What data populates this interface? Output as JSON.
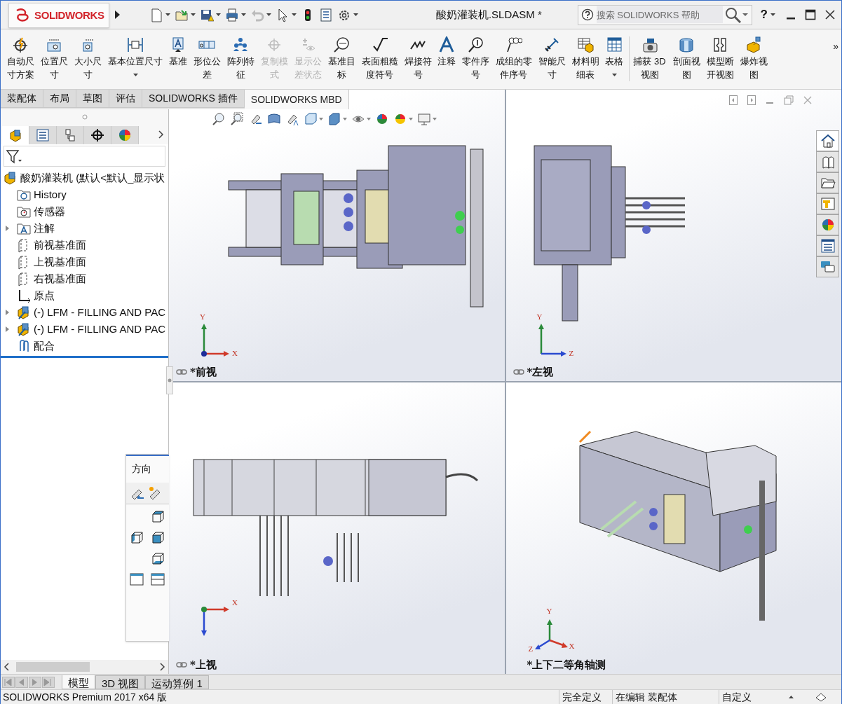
{
  "app": {
    "logo_text": "SOLIDWORKS"
  },
  "window": {
    "title": "酸奶灌装机.SLDASM *"
  },
  "search": {
    "placeholder": "搜索 SOLIDWORKS 帮助"
  },
  "help_menu": "?",
  "ribbon": {
    "buttons": [
      {
        "label": "自动尺寸方案",
        "disabled": false,
        "dropdown": false
      },
      {
        "label": "位置尺寸",
        "disabled": false,
        "dropdown": false
      },
      {
        "label": "大小尺寸",
        "disabled": false,
        "dropdown": false
      },
      {
        "label": "基本位置尺寸",
        "disabled": false,
        "dropdown": true
      },
      {
        "label": "基准",
        "disabled": false,
        "dropdown": false
      },
      {
        "label": "形位公差",
        "disabled": false,
        "dropdown": false
      },
      {
        "label": "阵列特征",
        "disabled": false,
        "dropdown": false
      },
      {
        "label": "复制模式",
        "disabled": true,
        "dropdown": false
      },
      {
        "label": "显示公差状态",
        "disabled": true,
        "dropdown": false
      },
      {
        "label": "基准目标",
        "disabled": false,
        "dropdown": false
      },
      {
        "label": "表面粗糙度符号",
        "disabled": false,
        "dropdown": false
      },
      {
        "label": "焊接符号",
        "disabled": false,
        "dropdown": false
      },
      {
        "label": "注释",
        "disabled": false,
        "dropdown": false
      },
      {
        "label": "零件序号",
        "disabled": false,
        "dropdown": false
      },
      {
        "label": "成组的零件序号",
        "disabled": false,
        "dropdown": false
      },
      {
        "label": "智能尺寸",
        "disabled": false,
        "dropdown": false
      },
      {
        "label": "材料明细表",
        "disabled": false,
        "dropdown": false
      },
      {
        "label": "表格",
        "disabled": false,
        "dropdown": true
      },
      {
        "label": "捕获 3D视图",
        "disabled": false,
        "dropdown": false
      },
      {
        "label": "剖面视图",
        "disabled": false,
        "dropdown": false
      },
      {
        "label": "模型断开视图",
        "disabled": false,
        "dropdown": false
      },
      {
        "label": "爆炸视图",
        "disabled": false,
        "dropdown": false
      }
    ],
    "overflow": "»"
  },
  "command_tabs": [
    {
      "label": "装配体",
      "selected": false
    },
    {
      "label": "布局",
      "selected": false
    },
    {
      "label": "草图",
      "selected": false
    },
    {
      "label": "评估",
      "selected": false
    },
    {
      "label": "SOLIDWORKS 插件",
      "selected": false
    },
    {
      "label": "SOLIDWORKS MBD",
      "selected": true
    }
  ],
  "feature_tree": {
    "panel_tabs": [
      {
        "selected": true
      },
      {
        "selected": false
      },
      {
        "selected": false
      },
      {
        "selected": false
      },
      {
        "selected": false
      }
    ],
    "root": {
      "label": "酸奶灌装机  (默认<默认_显示状",
      "kind": "assembly",
      "children": [
        {
          "label": "History",
          "kind": "history",
          "expandable": false
        },
        {
          "label": "传感器",
          "kind": "sensors",
          "expandable": false
        },
        {
          "label": "注解",
          "kind": "annotations",
          "expandable": true
        },
        {
          "label": "前视基准面",
          "kind": "plane",
          "expandable": false
        },
        {
          "label": "上视基准面",
          "kind": "plane",
          "expandable": false
        },
        {
          "label": "右视基准面",
          "kind": "plane",
          "expandable": false
        },
        {
          "label": "原点",
          "kind": "origin",
          "expandable": false
        },
        {
          "label": "(-) LFM - FILLING AND PAC",
          "kind": "subassembly",
          "expandable": true
        },
        {
          "label": "(-) LFM - FILLING AND PAC",
          "kind": "subassembly",
          "expandable": true
        },
        {
          "label": "配合",
          "kind": "mates",
          "expandable": false
        }
      ]
    }
  },
  "orientation_panel": {
    "title": "方向"
  },
  "viewports": [
    {
      "label": "*前视",
      "axes": [
        "Y",
        "X"
      ]
    },
    {
      "label": "*左视",
      "axes": [
        "Y",
        "Z"
      ]
    },
    {
      "label": "*上视",
      "axes": [
        "X"
      ]
    },
    {
      "label": "*上下二等角轴测",
      "axes": [
        "Y",
        "X",
        "Z"
      ]
    }
  ],
  "task_pane_tabs": [
    {
      "selected": true
    },
    {
      "selected": false
    },
    {
      "selected": false
    },
    {
      "selected": false
    },
    {
      "selected": false
    },
    {
      "selected": false
    },
    {
      "selected": false
    }
  ],
  "bottom_tabs": [
    {
      "label": "模型",
      "selected": true
    },
    {
      "label": "3D 视图",
      "selected": false
    },
    {
      "label": "运动算例 1",
      "selected": false
    }
  ],
  "status_bar": {
    "product": "SOLIDWORKS Premium 2017 x64 版",
    "fields": [
      "完全定义",
      "在编辑 装配体",
      "自定义"
    ]
  }
}
